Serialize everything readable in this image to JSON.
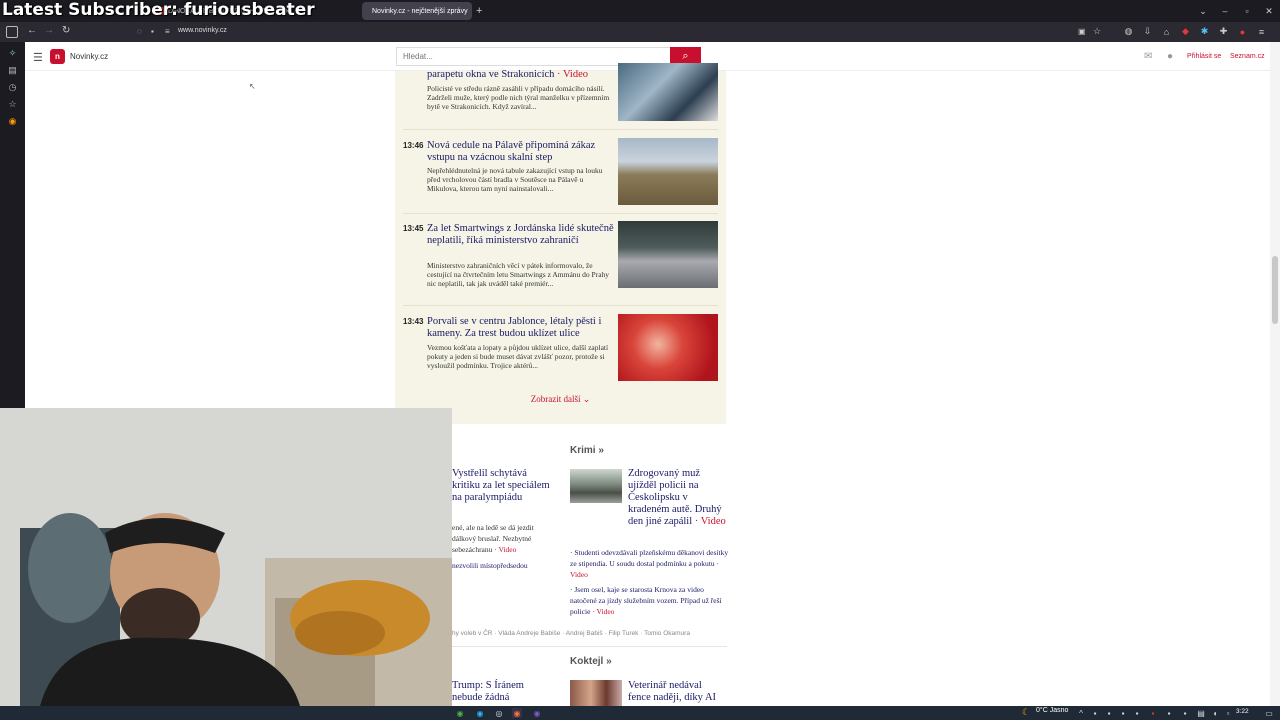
{
  "overlay": {
    "text": "Latest Subscriber: furiousbeater"
  },
  "tabs": [
    {
      "label": "DINOSAUŘI BYLI JEŠTĚ HORŠÍ..."
    },
    {
      "label": "Novinky.cz - nejčtenější zprávy"
    }
  ],
  "browser": {
    "url": "www.novinky.cz"
  },
  "site": {
    "logo_letter": "n",
    "name": "Novinky.cz",
    "search_placeholder": "Hledat...",
    "login": "Přihlásit se",
    "seznam": "Seznam.cz"
  },
  "feed": [
    {
      "time": "",
      "title": "parapetu okna ve Strakonicích",
      "video": "· Video",
      "summary": "Policisté ve středu rázně zasáhli v případu domácího násilí. Zadrželi muže, který podle nich týral manželku v přízemním bytě ve Strakonicích. Když zavíral..."
    },
    {
      "time": "13:46",
      "title": "Nová cedule na Pálavě připomíná zákaz vstupu na vzácnou skalní step",
      "video": "",
      "summary": "Nepřehlédnutelná je nová tabule zakazující vstup na louku před vrcholovou částí bradla v Soutěsce na Pálavě u Mikulova, kterou tam nyní nainstalovali..."
    },
    {
      "time": "13:45",
      "title": "Za let Smartwings z Jordánska lidé skutečně neplatili, říká ministerstvo zahraničí",
      "video": "",
      "summary": "Ministerstvo zahraničních věcí v pátek informovalo, že cestující na čtvrtečním letu Smartwings z Ammánu do Prahy nic neplatili, tak jak uváděl také premiér..."
    },
    {
      "time": "13:43",
      "title": "Porvali se v centru Jablonce, létaly pěsti i kameny. Za trest budou uklízet ulice",
      "video": "",
      "summary": "Vezmou košťata a lopaty a půjdou uklízet ulice, další zaplatí pokuty a jeden si bude muset dávat zvlášť pozor, protože si vysloužil podmínku. Trojice aktérů..."
    }
  ],
  "more_label": "Zobrazit další",
  "left_col": {
    "title": "Vystřelil schytává kritiku za let speciálem na paralympiádu",
    "summary_lines": [
      "ené, ale na ledě se dá jezdit",
      "dálkový bruslař. Nezbytné",
      "sebezáchranu"
    ],
    "summary_video": "· Video",
    "link": "nezvolili místopředsedou",
    "tags": "hy voleb v ČR · Vláda Andreje Babiše · Andrej Babiš · Filip Turek · Tomio Okamura",
    "title2_lines": [
      "Trump: S Íránem",
      "nebude žádná"
    ]
  },
  "krimi": {
    "section": "Krimi »",
    "title": "Zdrogovaný muž ujížděl policii na Českolipsku v kradeném autě. Druhý den jiné zapálil",
    "video": "· Video",
    "items": [
      {
        "text": "Studenti odevzdávali plzeňskému děkanovi desítky ze stipendia. U soudu dostal podmínku a pokutu",
        "video": "· Video"
      },
      {
        "text": "Jsem osel, kaje se starosta Krnova za video natočené za jízdy služebním vozem. Případ už řeší policie",
        "video": "· Video"
      }
    ]
  },
  "koktejl": {
    "section": "Koktejl »",
    "title_lines": [
      "Veterinář nedával",
      "fence naději, díky AI"
    ]
  },
  "taskbar": {
    "weather": "0°C Jasno",
    "time": "3:22"
  }
}
